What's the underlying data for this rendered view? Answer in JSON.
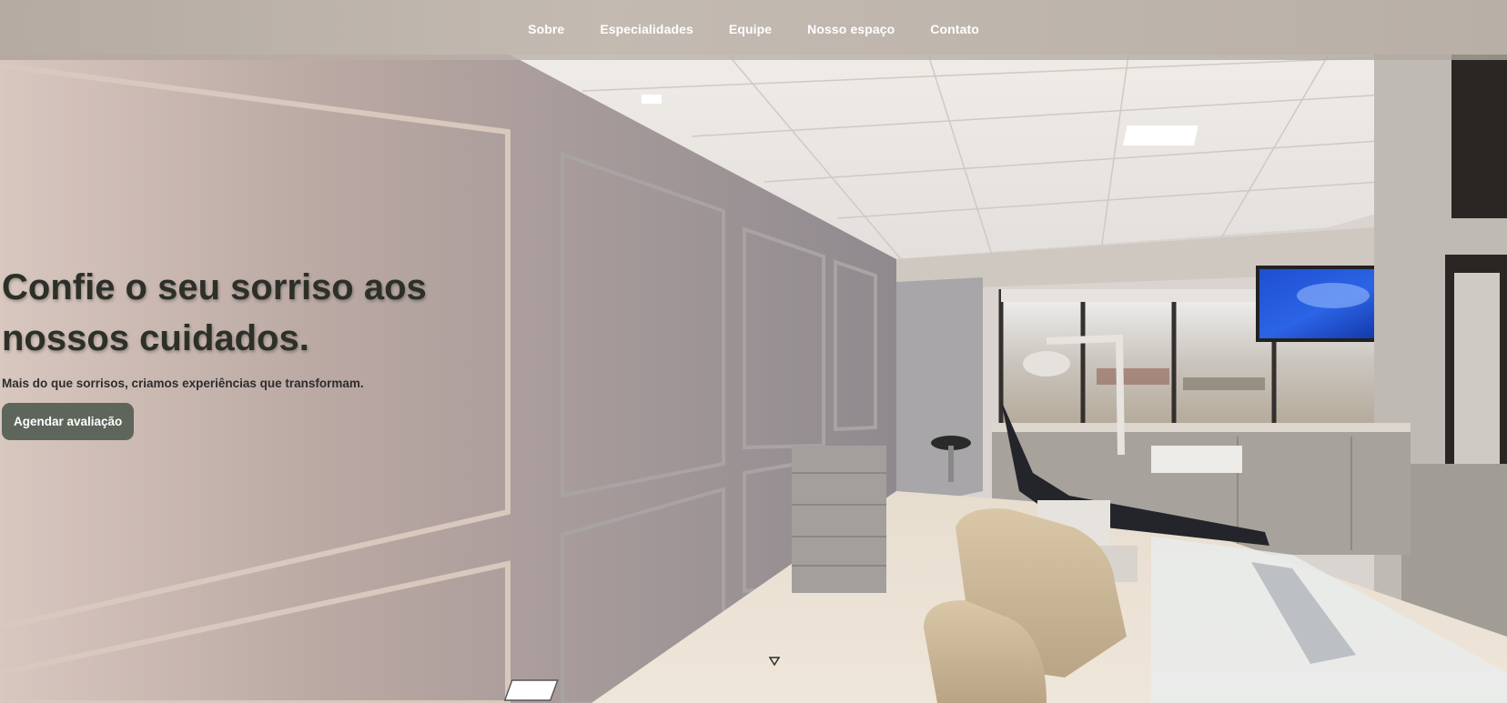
{
  "nav": {
    "items": [
      {
        "label": "Sobre"
      },
      {
        "label": "Especialidades"
      },
      {
        "label": "Equipe"
      },
      {
        "label": "Nosso espaço"
      },
      {
        "label": "Contato"
      }
    ]
  },
  "hero": {
    "title_line1": "Confie o seu sorriso aos",
    "title_line2": "nossos cuidados.",
    "subtitle": "Mais do que sorrisos, criamos experiências que transformam.",
    "cta_label": "Agendar avaliação"
  },
  "icons": {
    "scroll": "chevron-down-icon"
  },
  "colors": {
    "title": "#2c3028",
    "cta_background": "#5e665c",
    "nav_text": "#ffffff"
  }
}
